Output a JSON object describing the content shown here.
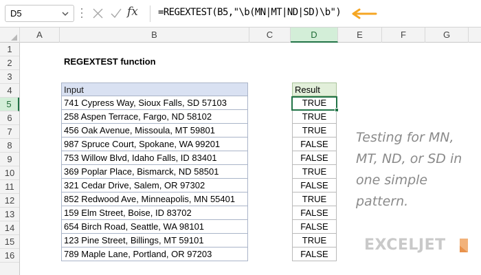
{
  "formula_bar": {
    "name_box": "D5",
    "formula": "=REGEXTEST(B5,\"\\b(MN|MT|ND|SD)\\b\")"
  },
  "columns": [
    "A",
    "B",
    "C",
    "D",
    "E",
    "F",
    "G"
  ],
  "selected_column": "D",
  "rows": [
    "1",
    "2",
    "3",
    "4",
    "5",
    "6",
    "7",
    "8",
    "9",
    "10",
    "11",
    "12",
    "13",
    "14",
    "15",
    "16"
  ],
  "selected_row": "5",
  "title": "REGEXTEST function",
  "input_header": "Input",
  "result_header": "Result",
  "table": [
    {
      "input": "741 Cypress Way, Sioux Falls, SD 57103",
      "result": "TRUE"
    },
    {
      "input": "258 Aspen Terrace, Fargo, ND 58102",
      "result": "TRUE"
    },
    {
      "input": "456 Oak Avenue, Missoula, MT 59801",
      "result": "TRUE"
    },
    {
      "input": "987 Spruce Court, Spokane, WA 99201",
      "result": "FALSE"
    },
    {
      "input": "753 Willow Blvd, Idaho Falls, ID 83401",
      "result": "FALSE"
    },
    {
      "input": "369 Poplar Place, Bismarck, ND 58501",
      "result": "TRUE"
    },
    {
      "input": "321 Cedar Drive, Salem, OR 97302",
      "result": "FALSE"
    },
    {
      "input": "852 Redwood Ave, Minneapolis, MN 55401",
      "result": "TRUE"
    },
    {
      "input": "159 Elm Street, Boise, ID 83702",
      "result": "FALSE"
    },
    {
      "input": "654 Birch Road, Seattle, WA 98101",
      "result": "FALSE"
    },
    {
      "input": "123 Pine Street, Billings, MT 59101",
      "result": "TRUE"
    },
    {
      "input": "789 Maple Lane, Portland, OR 97203",
      "result": "FALSE"
    }
  ],
  "annotation": "Testing for MN, MT, ND, or SD in one simple pattern.",
  "logo": "EXCELJET",
  "colors": {
    "accent_green": "#217346",
    "arrow": "#f5a623",
    "input_header_bg": "#d9e1f2",
    "result_header_bg": "#e2efda"
  },
  "icons": [
    "chevron-down-icon",
    "cancel-icon",
    "enter-icon",
    "fx-icon",
    "arrow-icon",
    "select-all-icon",
    "logo-mark-icon"
  ]
}
